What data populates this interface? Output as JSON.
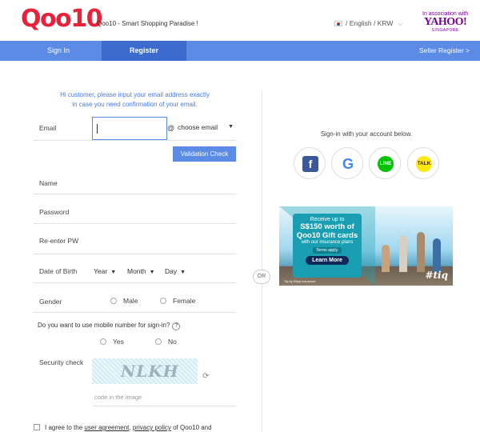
{
  "header": {
    "logo_text": "Qoo10",
    "slogan": "Qoo10 - Smart Shopping Paradise !",
    "language": "/ English / KRW",
    "partner_assoc": "In association with",
    "partner_name": "YAHOO!",
    "partner_region": "SINGAPORE",
    "brand_color": "#e8223a"
  },
  "nav": {
    "tabs": [
      {
        "label": "Sign In",
        "active": false
      },
      {
        "label": "Register",
        "active": true
      }
    ],
    "seller_link": "Seller Register  >",
    "bar_color": "#5b8be5"
  },
  "form": {
    "notice_line1": "Hi customer, please input your email address exactly",
    "notice_line2": "in case you need confirmation of your email.",
    "email_label": "Email",
    "email_value": "",
    "at_symbol": "@",
    "email_domain": "choose email",
    "validation_button": "Validation Check",
    "name_label": "Name",
    "password_label": "Password",
    "reenter_label": "Re-enter PW",
    "dob_label": "Date of Birth",
    "dob_year": "Year",
    "dob_month": "Month",
    "dob_day": "Day",
    "gender_label": "Gender",
    "gender_male": "Male",
    "gender_female": "Female",
    "mobile_question": "Do you want to use mobile number for sign-in?",
    "help_mark": "?",
    "mobile_yes": "Yes",
    "mobile_no": "No",
    "security_label": "Security check",
    "captcha_text": "NLKH",
    "code_hint": "code in the image",
    "agree_prefix": "I agree to the ",
    "agree_link1": "user agreement",
    "agree_sep": ", ",
    "agree_link2": "privacy policy",
    "agree_suffix": " of Qoo10 and"
  },
  "divider_label": "OR",
  "social": {
    "title": "Sign-in with your account below.",
    "providers": [
      {
        "name": "facebook",
        "glyph": "f"
      },
      {
        "name": "google",
        "glyph": "G"
      },
      {
        "name": "line",
        "glyph": "LINE"
      },
      {
        "name": "kakaotalk",
        "glyph": "TALK"
      }
    ]
  },
  "banner": {
    "line1": "Receive up to",
    "line2": "S$150 worth of",
    "line3": "Qoo10 Gift cards",
    "line4": "with our insurance plans",
    "terms": "Terms apply.",
    "cta": "Learn More",
    "brand": "#tiq",
    "byline": "Tiq by Etiqa Insurance"
  }
}
